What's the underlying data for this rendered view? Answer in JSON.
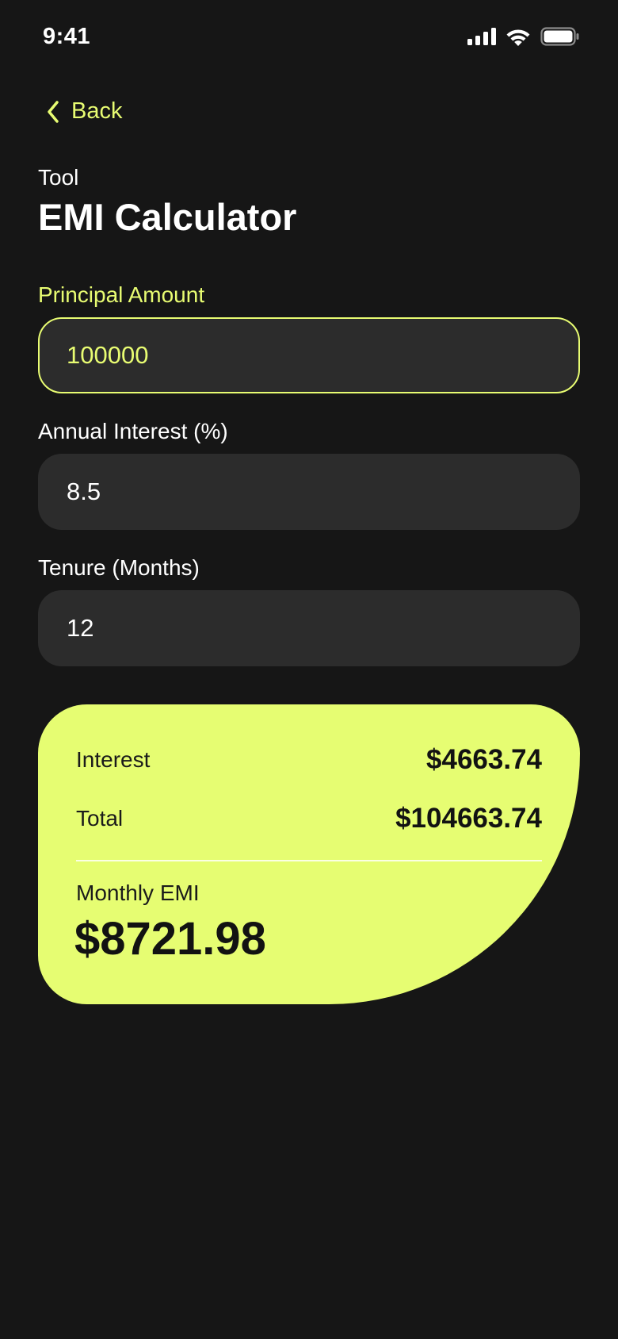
{
  "status_bar": {
    "time": "9:41",
    "icons": [
      "cellular-signal-icon",
      "wifi-icon",
      "battery-icon"
    ]
  },
  "nav": {
    "back_label": "Back",
    "back_icon": "chevron-left-icon"
  },
  "header": {
    "eyebrow": "Tool",
    "title": "EMI Calculator"
  },
  "form": {
    "principal": {
      "label": "Principal Amount",
      "value": "100000",
      "active": true
    },
    "interest": {
      "label": "Annual Interest (%)",
      "value": "8.5",
      "active": false
    },
    "tenure": {
      "label": "Tenure (Months)",
      "value": "12",
      "active": false
    }
  },
  "result": {
    "interest_label": "Interest",
    "interest_value": "$4663.74",
    "total_label": "Total",
    "total_value": "$104663.74",
    "emi_label": "Monthly EMI",
    "emi_value": "$8721.98"
  },
  "colors": {
    "background": "#161616",
    "accent": "#e6fd72",
    "field_background": "#2c2c2c",
    "text_primary": "#ffffff",
    "text_dark": "#121212"
  }
}
